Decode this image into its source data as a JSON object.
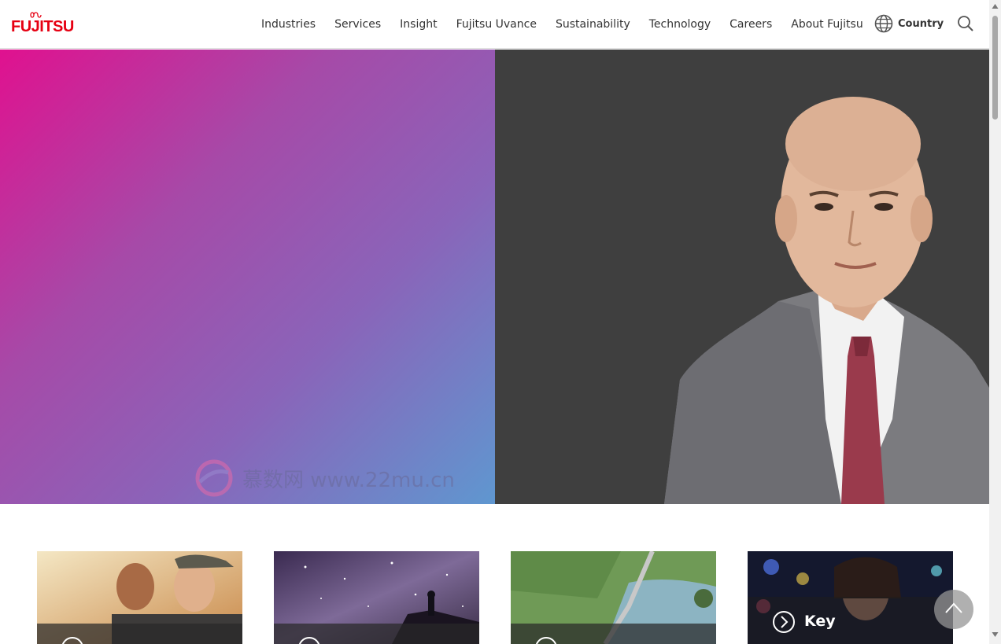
{
  "brand": {
    "name": "FUJITSU",
    "color": "#e60012"
  },
  "nav": {
    "items": [
      "Industries",
      "Services",
      "Insight",
      "Fujitsu Uvance",
      "Sustainability",
      "Technology",
      "Careers",
      "About Fujitsu"
    ],
    "country_label": "Country",
    "country_icon": "globe-icon",
    "search_icon": "search-icon"
  },
  "hero": {
    "gradient_colors": [
      "#e0118f",
      "#a64aa8",
      "#8a64b9",
      "#5f97d0"
    ],
    "portrait_background": "#3f3f3f"
  },
  "watermark": {
    "text": "慕数网 www.22mu.cn"
  },
  "cards": [
    {
      "image": "smiling-women-photo",
      "label": ""
    },
    {
      "image": "starry-sky-photo",
      "label": ""
    },
    {
      "image": "coastal-bridge-photo",
      "label": ""
    },
    {
      "image": "city-lights-photo",
      "label": "Key"
    }
  ],
  "back_to_top_icon": "chevron-up-icon"
}
